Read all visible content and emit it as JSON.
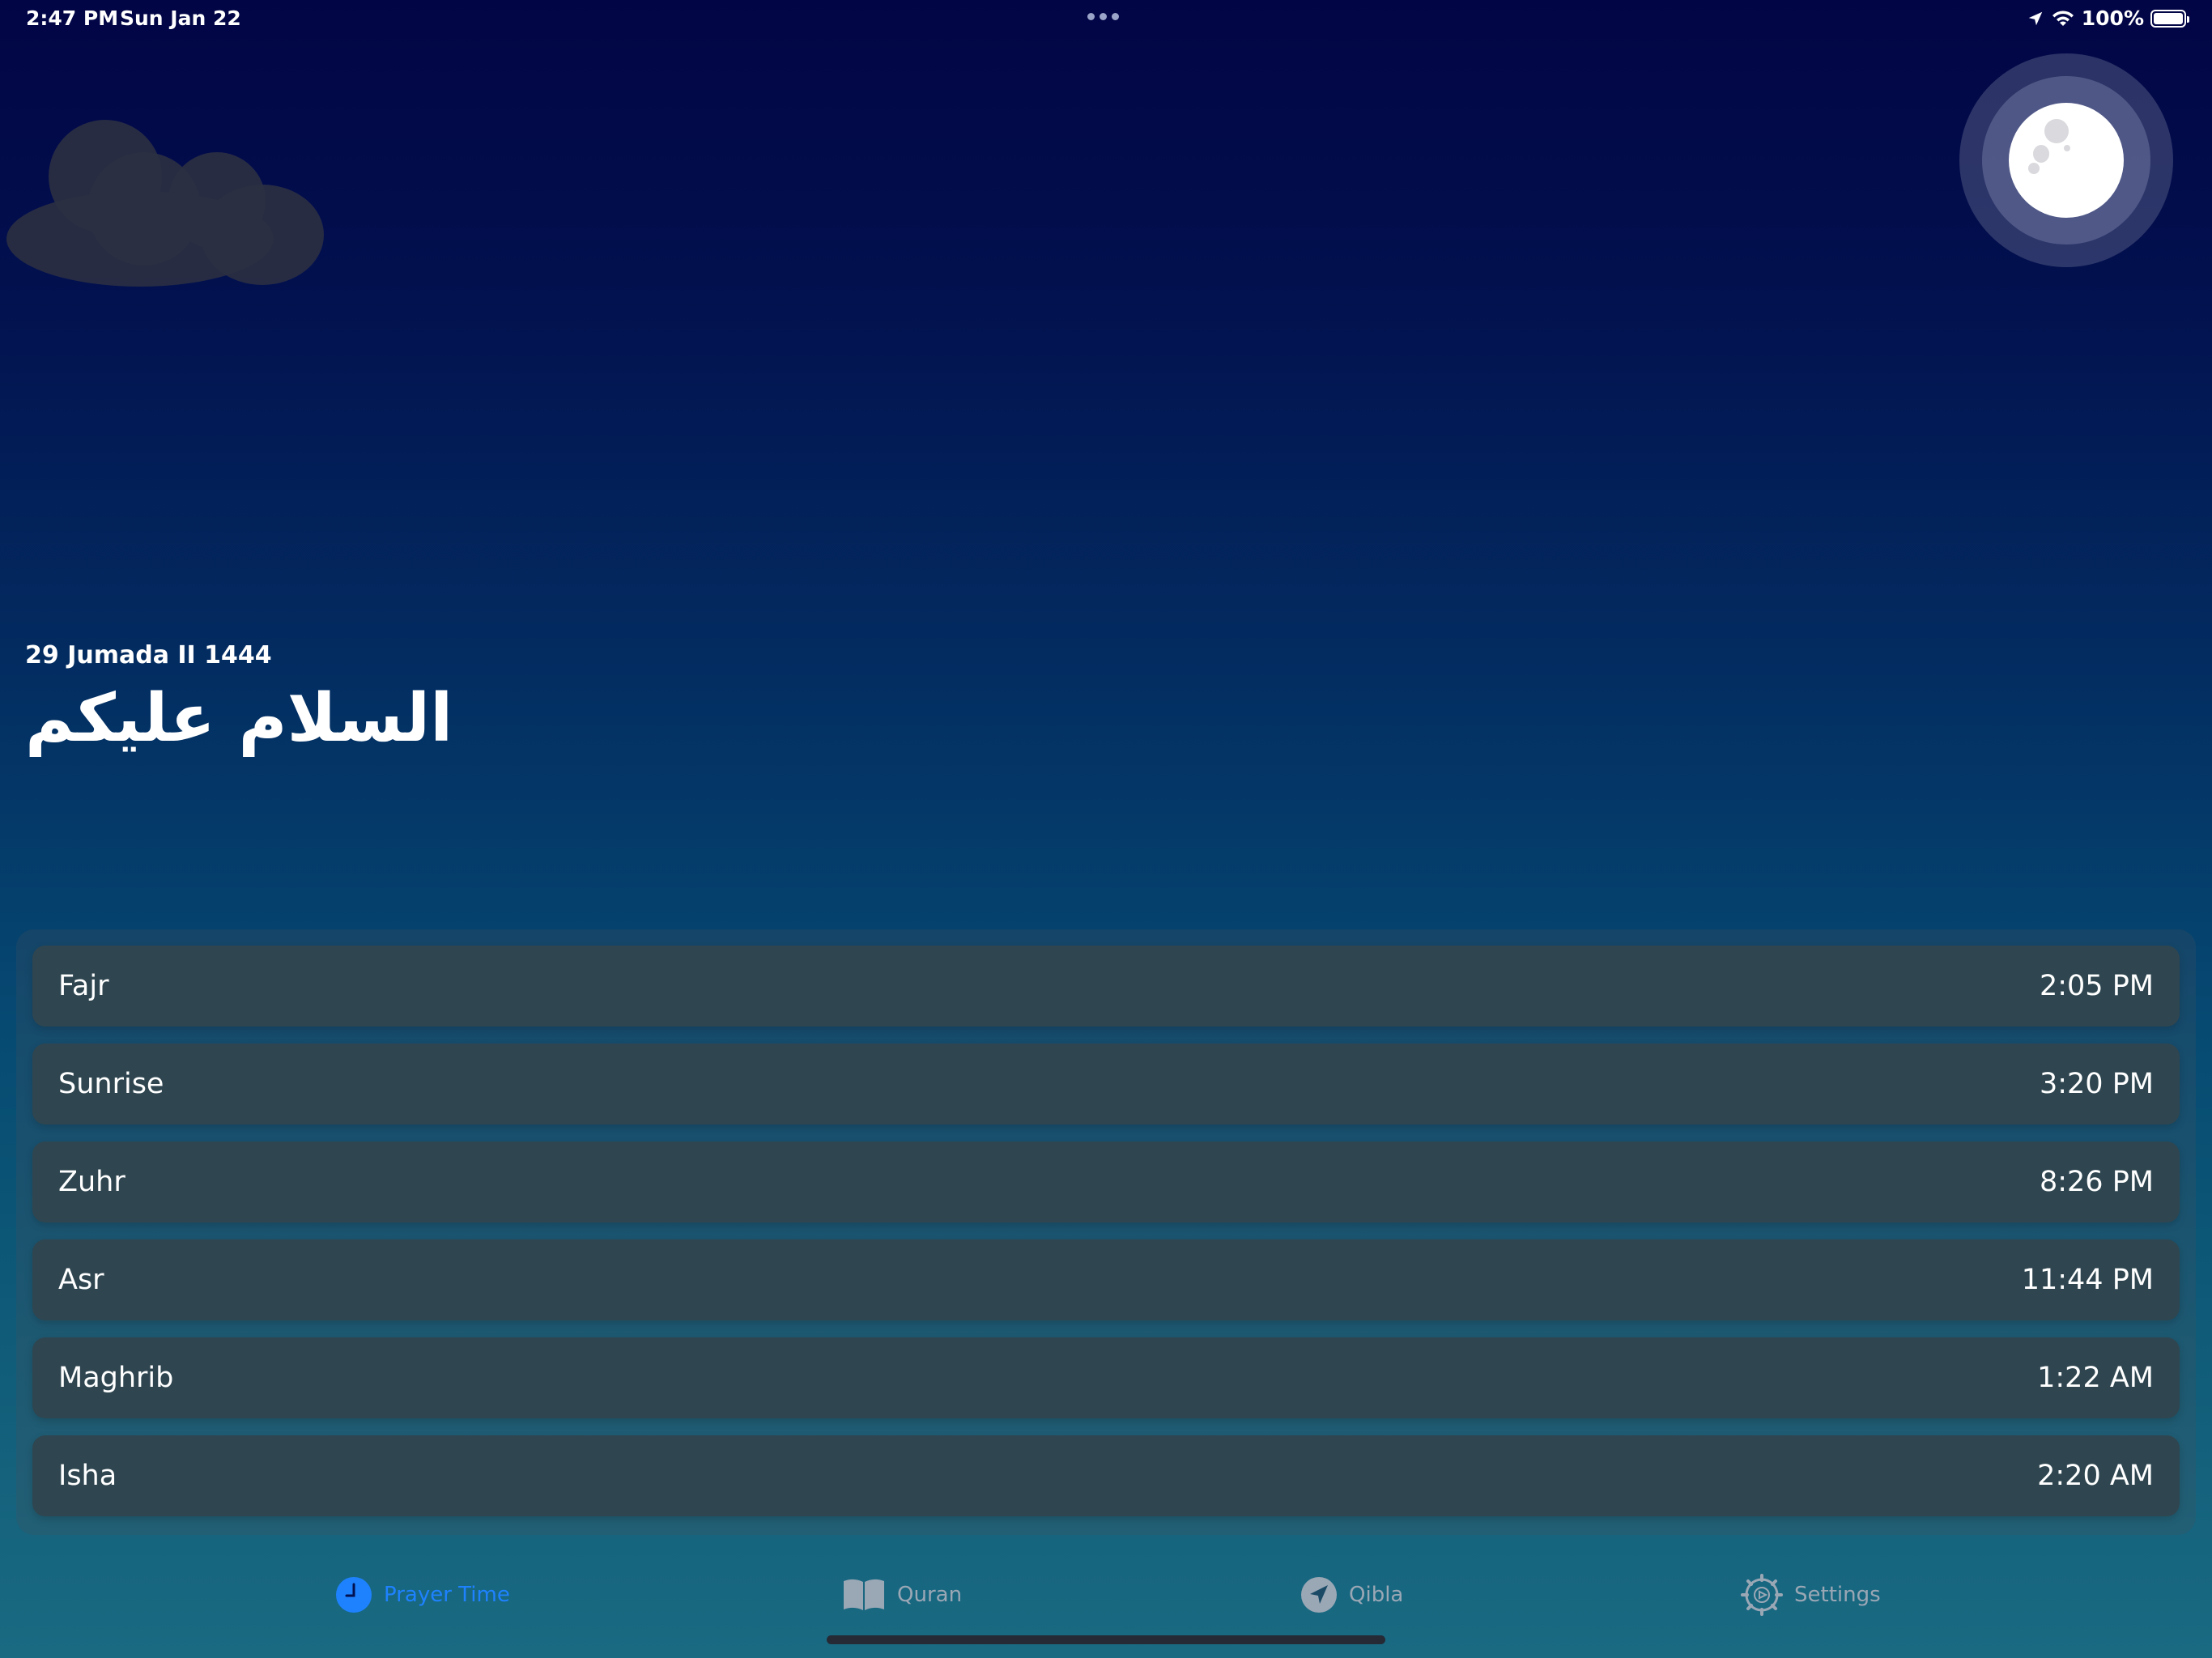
{
  "status_bar": {
    "time": "2:47 PM",
    "date": "Sun Jan 22",
    "battery": "100%"
  },
  "header": {
    "hijri_date": "29 Jumada II 1444",
    "greeting": "السلام عليكم"
  },
  "prayers": [
    {
      "name": "Fajr",
      "time": "2:05 PM"
    },
    {
      "name": "Sunrise",
      "time": "3:20 PM"
    },
    {
      "name": "Zuhr",
      "time": "8:26 PM"
    },
    {
      "name": "Asr",
      "time": "11:44 PM"
    },
    {
      "name": "Maghrib",
      "time": "1:22 AM"
    },
    {
      "name": "Isha",
      "time": "2:20 AM"
    }
  ],
  "tabs": [
    {
      "label": "Prayer Time",
      "icon": "clock-icon",
      "active": true
    },
    {
      "label": "Quran",
      "icon": "book-icon",
      "active": false
    },
    {
      "label": "Qibla",
      "icon": "compass-icon",
      "active": false
    },
    {
      "label": "Settings",
      "icon": "gear-icon",
      "active": false
    }
  ],
  "colors": {
    "accent": "#1e82ff",
    "tab_inactive": "#9aa7b5",
    "row_background": "#2f4650"
  }
}
